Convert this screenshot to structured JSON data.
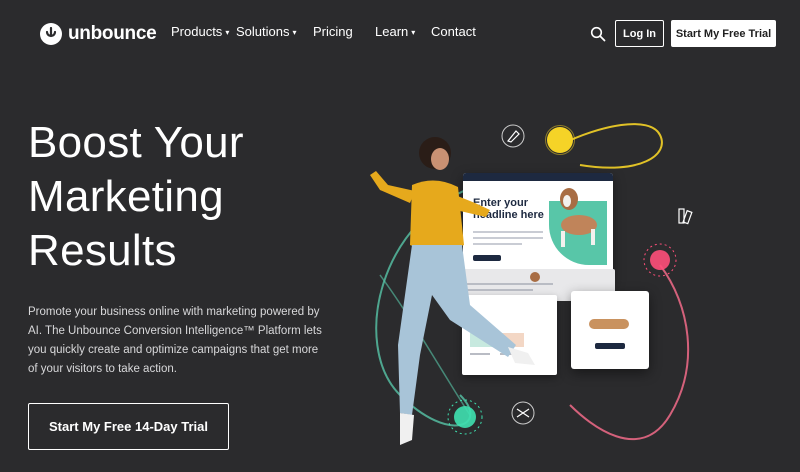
{
  "nav": {
    "logo_text": "unbounce",
    "items": [
      {
        "label": "Products",
        "has_dropdown": true
      },
      {
        "label": "Solutions",
        "has_dropdown": true
      },
      {
        "label": "Pricing",
        "has_dropdown": false
      },
      {
        "label": "Learn",
        "has_dropdown": true
      },
      {
        "label": "Contact",
        "has_dropdown": false
      }
    ],
    "search_icon": "search-icon",
    "login_label": "Log In",
    "trial_label": "Start My Free Trial"
  },
  "hero": {
    "headline_line1": "Boost Your",
    "headline_line2": "Marketing",
    "headline_line3": "Results",
    "subtext": "Promote your business online with marketing powered by AI. The Unbounce Conversion Intelligence™ Platform lets you quickly create and optimize campaigns that get more of your visitors to take action.",
    "cta_label": "Start My Free 14-Day Trial"
  },
  "illustration": {
    "landing_page_headline": "Enter your headline here"
  },
  "colors": {
    "background": "#2b2b2d",
    "accent_green": "#58c6a8",
    "accent_yellow": "#f5d327",
    "accent_pink": "#ff4f7a",
    "text": "#ffffff"
  }
}
